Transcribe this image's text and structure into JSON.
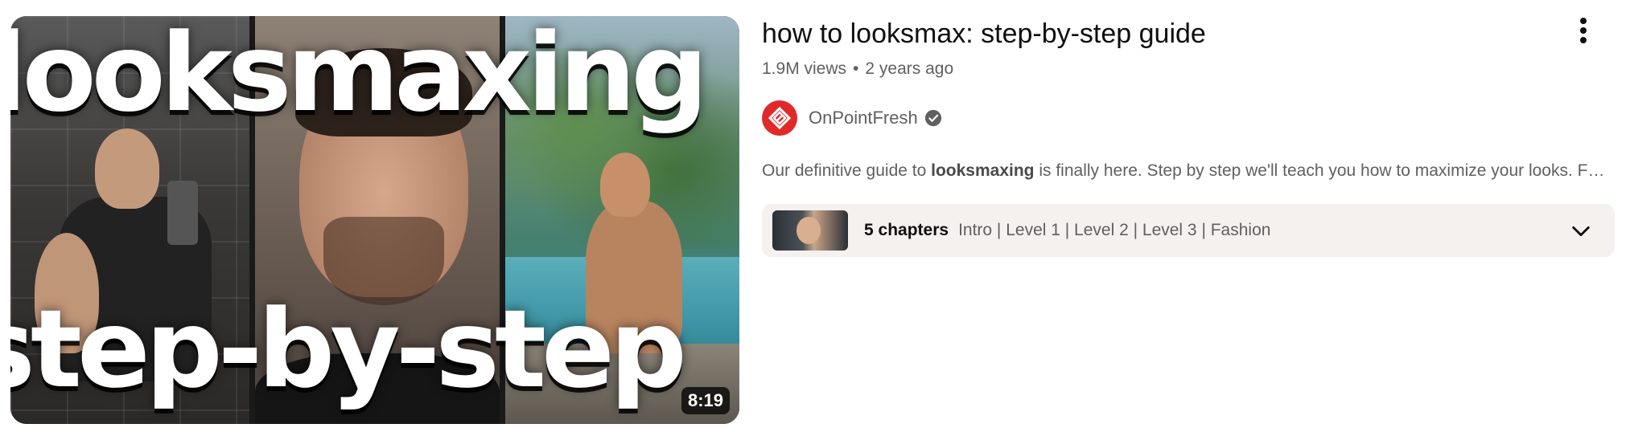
{
  "video": {
    "title": "how to looksmax: step-by-step guide",
    "views": "1.9M views",
    "separator": "•",
    "age": "2 years ago",
    "duration": "8:19",
    "thumbnail_text_top": "looksmaxing",
    "thumbnail_text_bottom": "step-by-step"
  },
  "channel": {
    "name": "OnPointFresh",
    "verified": true,
    "avatar_color": "#e02a2a",
    "verified_icon": "verified-check-icon"
  },
  "description": {
    "before": "Our definitive guide to ",
    "bold": "looksmaxing",
    "after": " is finally here. Step by step we'll teach you how to maximize your looks. F…"
  },
  "chapters": {
    "count_label": "5 chapters",
    "list": "Intro | Level 1 | Level 2 | Level 3 | Fashion",
    "expand_icon": "chevron-down-icon"
  },
  "menu": {
    "icon": "more-vert-icon"
  }
}
